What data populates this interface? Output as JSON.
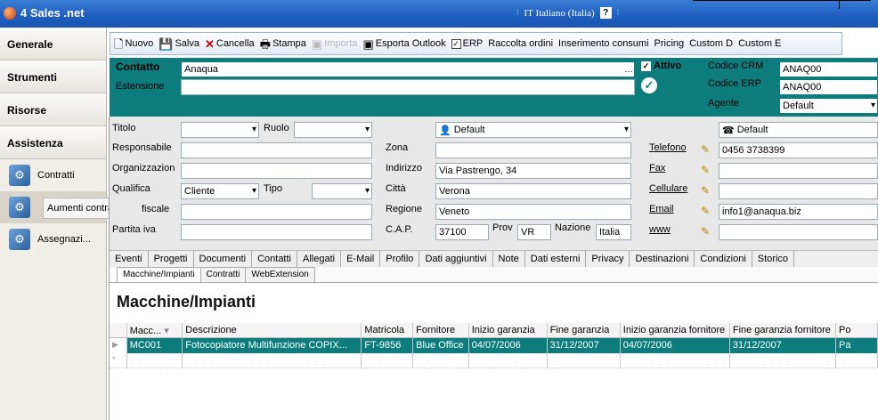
{
  "app": {
    "title": "4 Sales .net",
    "language": "IT Italiano (Italia)",
    "help": "?"
  },
  "nav": {
    "sections": [
      "Generale",
      "Strumenti",
      "Risorse",
      "Assistenza"
    ],
    "items": [
      {
        "label": "Contratti"
      },
      {
        "label": "Aumenti contrattuali"
      },
      {
        "label": "Assegnazi..."
      }
    ],
    "tooltip": "Aumenti contrattuali"
  },
  "toolbar": {
    "nuovo": "Nuovo",
    "salva": "Salva",
    "cancella": "Cancella",
    "stampa": "Stampa",
    "importa": "Importa",
    "esporta": "Esporta Outlook",
    "erp": "ERP",
    "raccolta": "Raccolta ordini",
    "inserimento": "Inserimento consumi",
    "pricing": "Pricing",
    "custom_d": "Custom D",
    "custom_e": "Custom E"
  },
  "header": {
    "contatto_label": "Contatto",
    "contatto_value": "Anaqua",
    "estensione_label": "Estensione",
    "attivo_label": "Attivo",
    "crm_label": "Codice CRM",
    "crm_value": "ANAQ00",
    "erp_label": "Codice ERP",
    "erp_value": "ANAQ00",
    "agente_label": "Agente",
    "agente_value": "Default"
  },
  "form": {
    "titolo": "Titolo",
    "ruolo": "Ruolo",
    "responsabile": "Responsabile",
    "organizzazione": "Organizzazion",
    "qualifica": "Qualifica",
    "qualifica_value": "Cliente",
    "tipo": "Tipo",
    "fiscale": "fiscale",
    "partita_iva": "Partita iva",
    "zona": "Zona",
    "indirizzo": "Indirizzo",
    "indirizzo_value": "Via Pastrengo, 34",
    "citta": "Città",
    "citta_value": "Verona",
    "regione": "Regione",
    "regione_value": "Veneto",
    "cap": "C.A.P.",
    "cap_value": "37100",
    "prov": "Prov",
    "prov_value": "VR",
    "nazione": "Nazione",
    "nazione_value": "Italia",
    "default_user": "Default",
    "default_right": "Default",
    "telefono": "Telefono",
    "telefono_value": "0456 3738399",
    "fax": "Fax",
    "cellulare": "Cellulare",
    "email": "Email",
    "email_value": "info1@anaqua.biz",
    "www": "www"
  },
  "tabs": [
    "Eventi",
    "Progetti",
    "Documenti",
    "Contatti",
    "Allegati",
    "E-Mail",
    "Profilo",
    "Dati aggiuntivi",
    "Note",
    "Dati esterni",
    "Privacy",
    "Destinazioni",
    "Condizioni",
    "Storico"
  ],
  "subtabs": [
    "Macchine/Impianti",
    "Contratti",
    "WebExtension"
  ],
  "section_title": "Macchine/Impianti",
  "grid": {
    "headers": [
      "Macc...",
      "Descrizione",
      "Matricola",
      "Fornitore",
      "Inizio garanzia",
      "Fine garanzia",
      "Inizio garanzia fornitore",
      "Fine garanzia fornitore",
      "Po"
    ],
    "row": [
      "MC001",
      "Fotocopiatore Multifunzione COPIX...",
      "FT-9856",
      "Blue Office",
      "04/07/2006",
      "31/12/2007",
      "04/07/2006",
      "31/12/2007",
      "Pa"
    ],
    "new_row_marker": "*"
  },
  "colors": {
    "accent": "#0d7c7c",
    "titlebar": "#1f5fc0"
  }
}
